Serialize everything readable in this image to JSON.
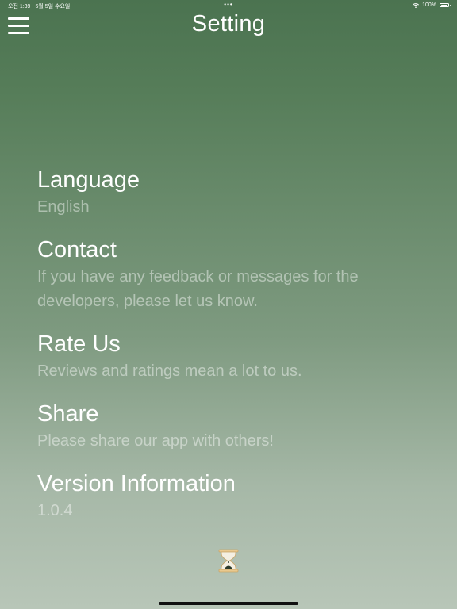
{
  "status_bar": {
    "time": "오전 1:39",
    "date": "6월 5일 수요일",
    "dots": "•••",
    "battery_percent": "100%"
  },
  "header": {
    "title": "Setting"
  },
  "settings": [
    {
      "title": "Language",
      "description": "English"
    },
    {
      "title": "Contact",
      "description": "If you have any feedback or messages for the developers, please let us know."
    },
    {
      "title": "Rate Us",
      "description": "Reviews and ratings mean a lot to us."
    },
    {
      "title": "Share",
      "description": "Please share our app with others!"
    },
    {
      "title": "Version Information",
      "description": "1.0.4"
    }
  ],
  "icons": {
    "menu": "hamburger-menu-icon",
    "loading": "hourglass-icon",
    "wifi": "wifi-icon",
    "battery": "battery-icon"
  },
  "colors": {
    "background_top": "#4b7350",
    "background_bottom": "#b8c6b8",
    "title_text": "#ffffff",
    "description_text": "rgba(255,255,255,0.45)"
  }
}
